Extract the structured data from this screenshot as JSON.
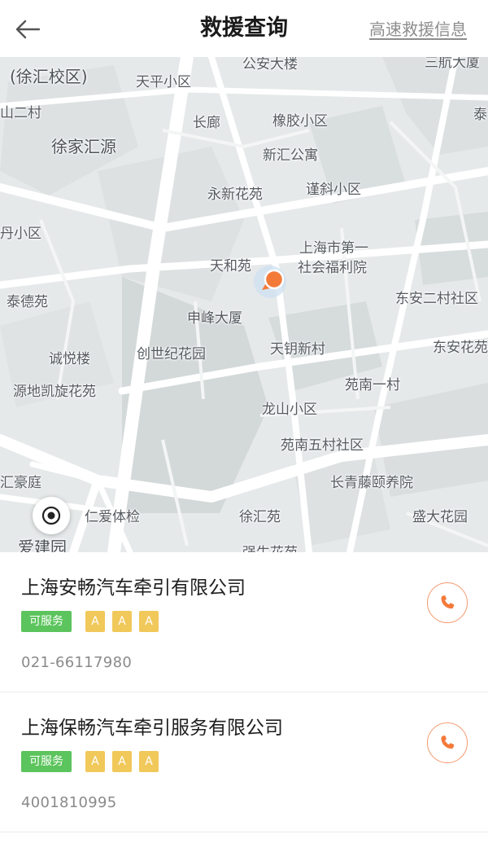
{
  "header": {
    "title": "救援查询",
    "link_label": "高速救援信息",
    "back_icon": "arrow-left-icon"
  },
  "map": {
    "labels": [
      "(徐汇校区)",
      "公安大楼",
      "天平小区",
      "三航大厦",
      "泰",
      "山二村",
      "长廊",
      "橡胶小区",
      "徐家汇源",
      "新汇公寓",
      "永新花苑",
      "谨斜小区",
      "丹小区",
      "上海市第一",
      "社会福利院",
      "天和苑",
      "泰德苑",
      "申峰大厦",
      "东安二村社区",
      "诚悦楼",
      "创世纪花园",
      "天钥新村",
      "东安花苑",
      "苑南一村",
      "源地凯旋花苑",
      "龙山小区",
      "苑南五村社区",
      "汇豪庭",
      "长青藤颐养院",
      "仁爱体检",
      "徐汇苑",
      "盛大花园",
      "爱建园",
      "强生花苑"
    ],
    "accent_color": "#f47a3a",
    "marker_icon": "location-pin-icon",
    "locate_icon": "locate-target-icon"
  },
  "companies": [
    {
      "name": "上海安畅汽车牵引有限公司",
      "status": "可服务",
      "ratings": [
        "A",
        "A",
        "A"
      ],
      "phone": "021-66117980"
    },
    {
      "name": "上海保畅汽车牵引服务有限公司",
      "status": "可服务",
      "ratings": [
        "A",
        "A",
        "A"
      ],
      "phone": "4001810995"
    }
  ],
  "colors": {
    "status_green": "#5cc45d",
    "rating_yellow": "#f1c85a",
    "phone_orange": "#f47a3a"
  }
}
